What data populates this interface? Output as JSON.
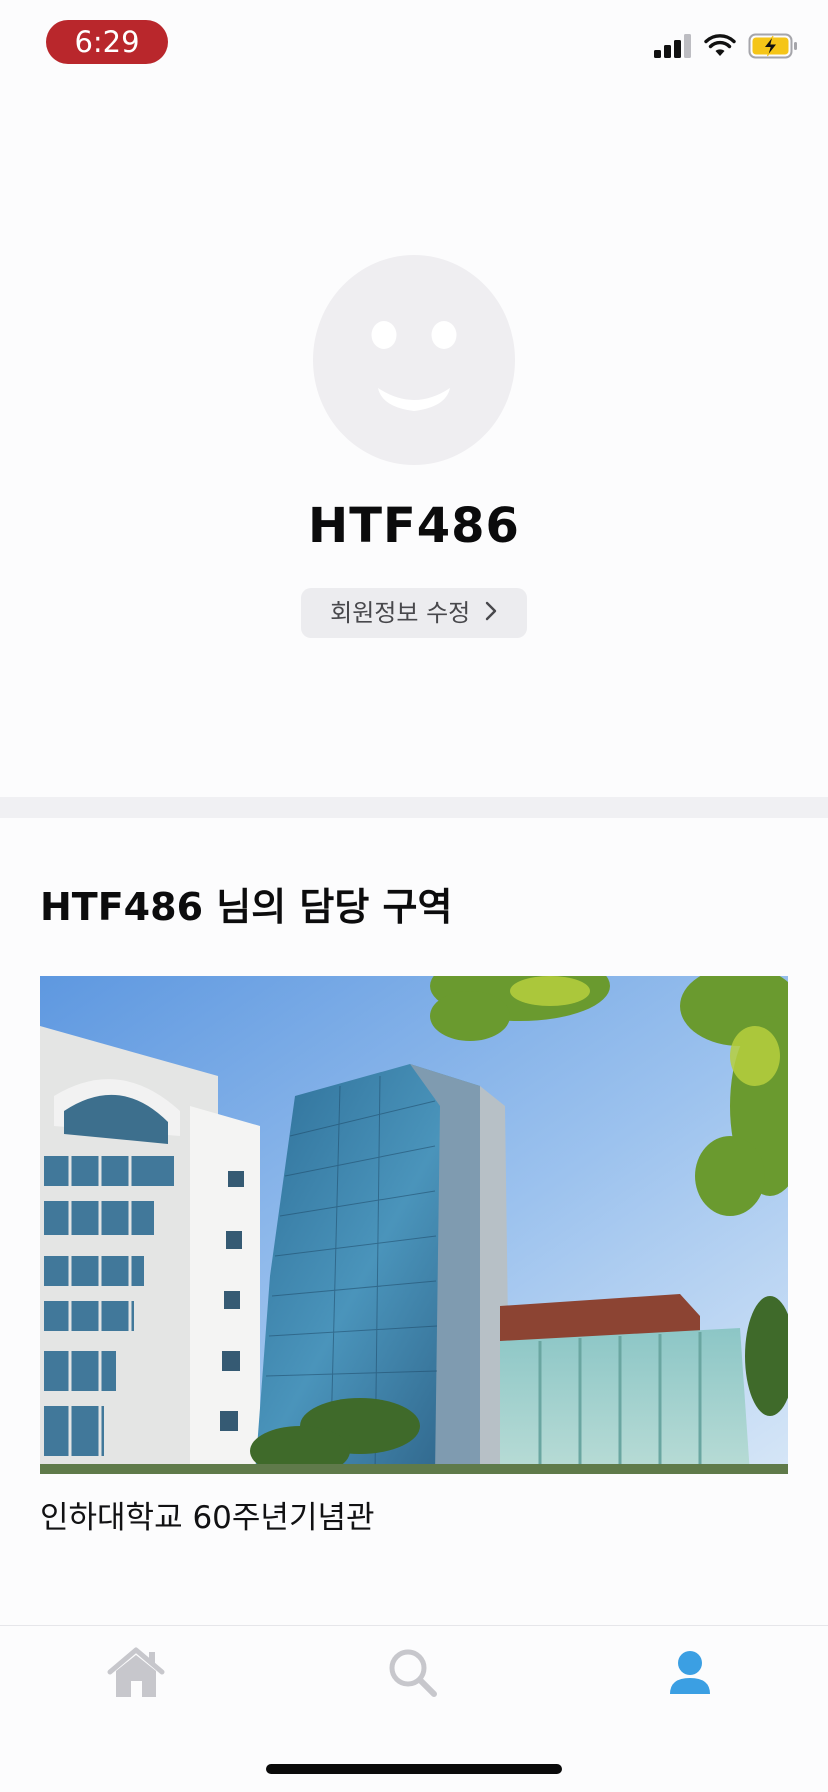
{
  "status_bar": {
    "time": "6:29",
    "time_pill_color": "#b9272c",
    "icons": [
      "cellular-signal-icon",
      "wifi-icon",
      "battery-charging-icon"
    ]
  },
  "profile": {
    "username": "HTF486",
    "edit_button_label": "회원정보 수정",
    "avatar_icon": "smiley-face-icon"
  },
  "assigned_area": {
    "title": "HTF486 님의 담당 구역",
    "place_name": "인하대학교 60주년기념관"
  },
  "tab_bar": {
    "tabs": [
      {
        "name": "home",
        "icon": "home-icon",
        "active": false
      },
      {
        "name": "search",
        "icon": "search-icon",
        "active": false
      },
      {
        "name": "profile",
        "icon": "person-icon",
        "active": true
      }
    ],
    "active_color": "#3b9fe3",
    "inactive_color": "#c7c7cc"
  }
}
